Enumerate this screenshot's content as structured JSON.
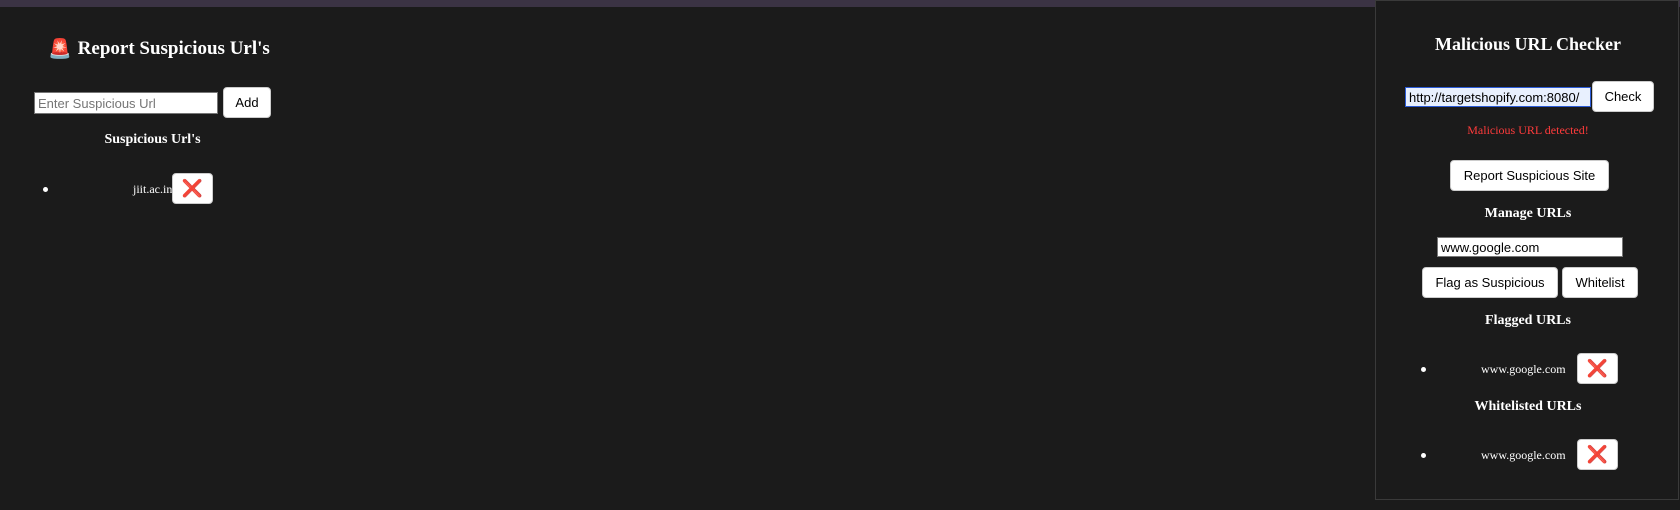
{
  "left_panel": {
    "title_icon": "siren-icon",
    "title": "Report Suspicious Url's",
    "input_placeholder": "Enter Suspicious Url",
    "input_value": "",
    "add_label": "Add",
    "list_heading": "Suspicious Url's",
    "items": [
      {
        "url": "jiit.ac.in",
        "remove_glyph": "❌"
      }
    ]
  },
  "right_panel": {
    "title": "Malicious URL Checker",
    "url_value": "http://targetshopify.com:8080/",
    "check_label": "Check",
    "alert_text": "Malicious URL detected!",
    "alert_color": "#ff3b3b",
    "report_label": "Report Suspicious Site",
    "manage_heading": "Manage URLs",
    "manage_value": "www.google.com",
    "flag_label": "Flag as Suspicious",
    "whitelist_label": "Whitelist",
    "flagged_heading": "Flagged URLs",
    "flagged": [
      {
        "url": "www.google.com",
        "remove_glyph": "❌"
      }
    ],
    "whitelisted_heading": "Whitelisted URLs",
    "whitelisted": [
      {
        "url": "www.google.com",
        "remove_glyph": "❌"
      }
    ]
  }
}
